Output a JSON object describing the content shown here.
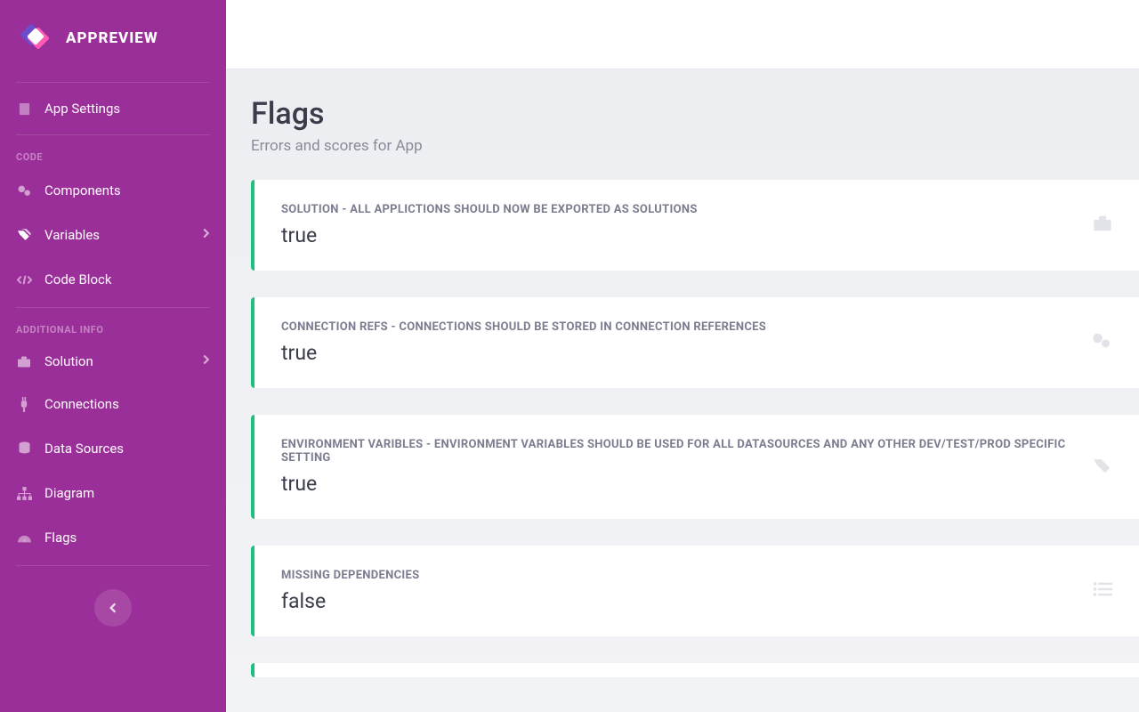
{
  "brand": {
    "title": "APPREVIEW"
  },
  "nav": {
    "settings": "App Settings",
    "section_code": "CODE",
    "components": "Components",
    "variables": "Variables",
    "codeblock": "Code Block",
    "section_additional": "ADDITIONAL INFO",
    "solution": "Solution",
    "connections": "Connections",
    "datasources": "Data Sources",
    "diagram": "Diagram",
    "flags": "Flags"
  },
  "page": {
    "title": "Flags",
    "subtitle": "Errors and scores for App"
  },
  "cards": [
    {
      "label": "SOLUTION - ALL APPLICTIONS SHOULD NOW BE EXPORTED AS SOLUTIONS",
      "value": "true"
    },
    {
      "label": "CONNECTION REFS - CONNECTIONS SHOULD BE STORED IN CONNECTION REFERENCES",
      "value": "true"
    },
    {
      "label": "ENVIRONMENT VARIBLES - ENVIRONMENT VARIABLES SHOULD BE USED FOR ALL DATASOURCES AND ANY OTHER DEV/TEST/PROD SPECIFIC SETTING",
      "value": "true"
    },
    {
      "label": "MISSING DEPENDENCIES",
      "value": "false"
    }
  ]
}
